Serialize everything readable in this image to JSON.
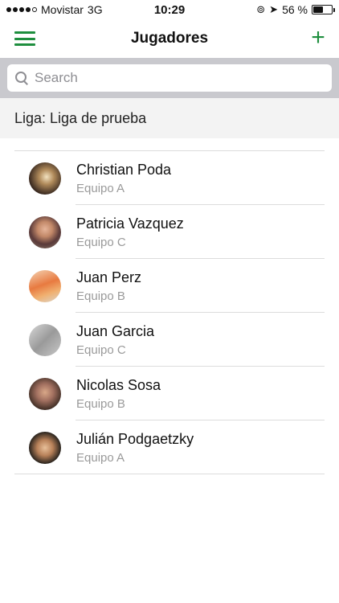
{
  "status_bar": {
    "carrier": "Movistar",
    "network": "3G",
    "time": "10:29",
    "battery_percent": "56 %",
    "battery_level": 0.56
  },
  "nav": {
    "title": "Jugadores",
    "menu_icon": "hamburger-menu-icon",
    "add_icon": "plus-icon",
    "accent_color": "#1e8e3e"
  },
  "search": {
    "placeholder": "Search",
    "value": ""
  },
  "league": {
    "label": "Liga: Liga de prueba"
  },
  "players": [
    {
      "name": "Christian Poda",
      "team": "Equipo A"
    },
    {
      "name": "Patricia Vazquez",
      "team": "Equipo C"
    },
    {
      "name": "Juan Perz",
      "team": "Equipo B"
    },
    {
      "name": "Juan Garcia",
      "team": "Equipo C"
    },
    {
      "name": "Nicolas Sosa",
      "team": "Equipo B"
    },
    {
      "name": "Julián Podgaetzky",
      "team": "Equipo A"
    }
  ]
}
